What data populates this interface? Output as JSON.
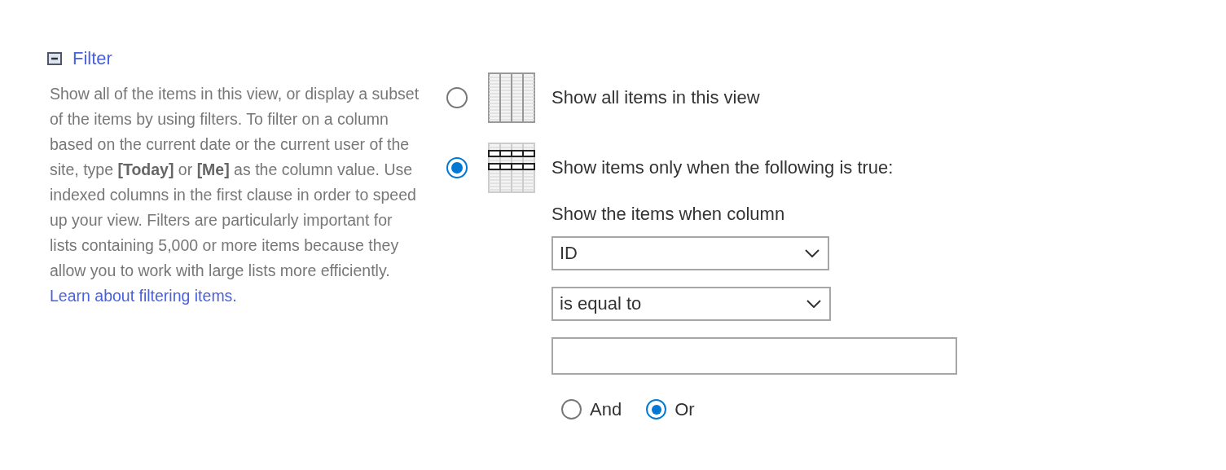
{
  "section": {
    "title": "Filter",
    "expanded": true,
    "description": "Show all of the items in this view, or display a subset of the items by using filters. To filter on a column based on the current date or the current user of the site, type **[Today]** or **[Me]** as the column value. Use indexed columns in the first clause in order to speed up your view. Filters are particularly important for lists containing 5,000 or more items because they allow you to work with large lists more efficiently.",
    "link": "Learn about filtering items."
  },
  "options": [
    {
      "label": "Show all items in this view",
      "selected": false,
      "kind": "all"
    },
    {
      "label": "Show items only when the following is true:",
      "selected": true,
      "kind": "filtered"
    }
  ],
  "condition": {
    "label": "Show the items when column",
    "column": "ID",
    "operator": "is equal to",
    "joins": [
      {
        "label": "And",
        "selected": false
      },
      {
        "label": "Or",
        "selected": true
      }
    ]
  }
}
